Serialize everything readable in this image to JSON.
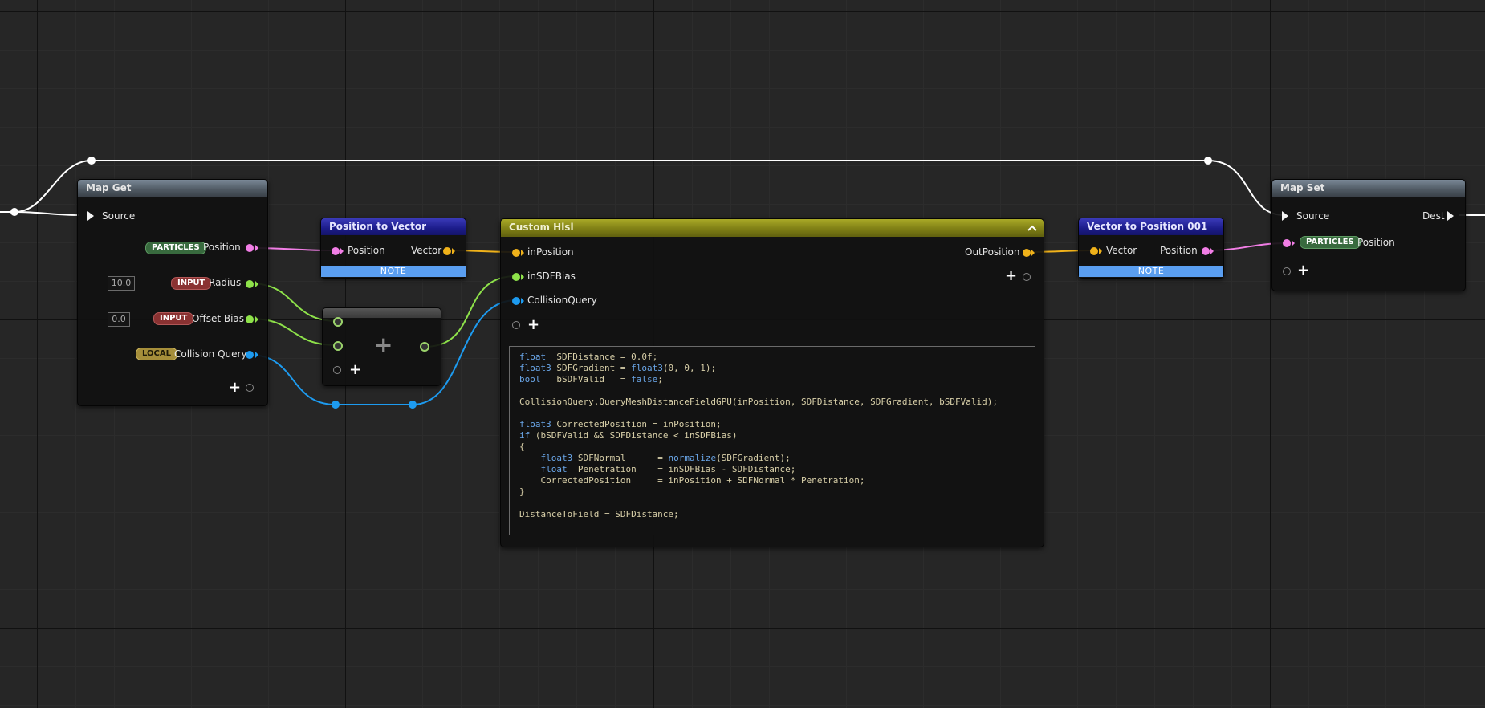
{
  "colors": {
    "grid_bg": "#262626",
    "wire_white": "#ffffff",
    "wire_pink": "#f27ee6",
    "wire_green": "#8ee24a",
    "wire_blue": "#1d9bf0",
    "wire_yellow": "#f0b21a"
  },
  "map_get": {
    "title": "Map Get",
    "source_label": "Source",
    "position": {
      "badge": "PARTICLES",
      "label": "Position"
    },
    "radius": {
      "value": "10.0",
      "badge": "INPUT",
      "label": "Radius"
    },
    "offset_bias": {
      "value": "0.0",
      "badge": "INPUT",
      "label": "Offset Bias"
    },
    "collision_query": {
      "badge": "LOCAL",
      "label": "Collision Query"
    },
    "add_icon": "plus-icon"
  },
  "pos_to_vec": {
    "title": "Position to Vector",
    "in_label": "Position",
    "out_label": "Vector",
    "note": "NOTE"
  },
  "add_node": {
    "operator": "+",
    "add_icon": "plus-icon"
  },
  "custom_hlsl": {
    "title": "Custom Hlsl",
    "inputs": [
      "inPosition",
      "inSDFBias",
      "CollisionQuery"
    ],
    "output": "OutPosition",
    "collapse_icon": "chevron-up-icon",
    "code_lines": [
      "float  SDFDistance = 0.0f;",
      "float3 SDFGradient = float3(0, 0, 1);",
      "bool   bSDFValid   = false;",
      "",
      "CollisionQuery.QueryMeshDistanceFieldGPU(inPosition, SDFDistance, SDFGradient, bSDFValid);",
      "",
      "float3 CorrectedPosition = inPosition;",
      "if (bSDFValid && SDFDistance < inSDFBias)",
      "{",
      "    float3 SDFNormal      = normalize(SDFGradient);",
      "    float  Penetration    = inSDFBias - SDFDistance;",
      "    CorrectedPosition     = inPosition + SDFNormal * Penetration;",
      "}",
      "",
      "DistanceToField = SDFDistance;"
    ]
  },
  "vec_to_pos": {
    "title": "Vector to Position 001",
    "in_label": "Vector",
    "out_label": "Position",
    "note": "NOTE"
  },
  "map_set": {
    "title": "Map Set",
    "source_label": "Source",
    "dest_label": "Dest",
    "position": {
      "badge": "PARTICLES",
      "label": "Position"
    },
    "add_icon": "plus-icon"
  }
}
